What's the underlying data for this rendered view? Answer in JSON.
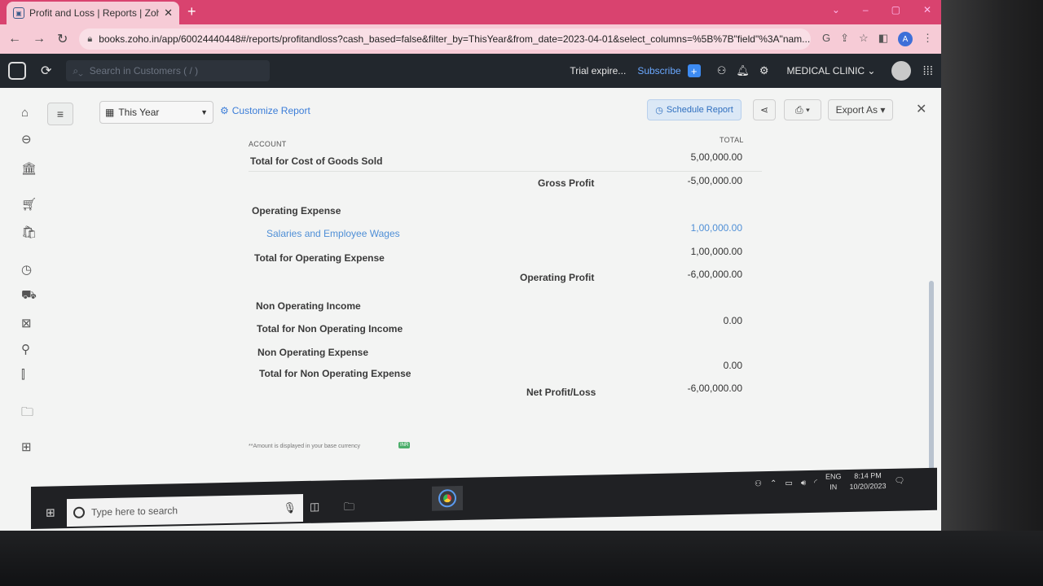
{
  "browser": {
    "tab_title": "Profit and Loss | Reports | Zoho",
    "url": "books.zoho.in/app/60024440448#/reports/profitandloss?cash_based=false&filter_by=ThisYear&from_date=2023-04-01&select_columns=%5B%7B\"field\"%3A\"nam...",
    "profile_initial": "A",
    "accent": "#d9436f"
  },
  "header": {
    "search_placeholder": "Search in Customers ( / )",
    "trial_text": "Trial expire...",
    "subscribe_label": "Subscribe",
    "org_name": "MEDICAL CLINIC"
  },
  "toolbar": {
    "period": "This Year",
    "customize_label": "Customize Report",
    "schedule_label": "Schedule Report",
    "export_label": "Export As"
  },
  "report": {
    "col_account": "ACCOUNT",
    "col_total": "TOTAL",
    "rows": {
      "cogs_total_label": "Total for Cost of Goods Sold",
      "cogs_total_value": "5,00,000.00",
      "gross_profit_label": "Gross Profit",
      "gross_profit_value": "-5,00,000.00",
      "opex_heading": "Operating Expense",
      "salaries_label": "Salaries and Employee Wages",
      "salaries_value": "1,00,000.00",
      "opex_total_label": "Total for Operating Expense",
      "opex_total_value": "1,00,000.00",
      "operating_profit_label": "Operating Profit",
      "operating_profit_value": "-6,00,000.00",
      "noi_heading": "Non Operating Income",
      "noi_total_label": "Total for Non Operating Income",
      "noi_total_value": "0.00",
      "noe_heading": "Non Operating Expense",
      "noe_total_label": "Total for Non Operating Expense",
      "noe_total_value": "0.00",
      "net_label": "Net Profit/Loss",
      "net_value": "-6,00,000.00"
    },
    "footnote": "**Amount is displayed in your base currency",
    "currency": "INR"
  },
  "taskbar": {
    "search_placeholder": "Type here to search",
    "lang_top": "ENG",
    "lang_bottom": "IN",
    "time": "8:14 PM",
    "date": "10/20/2023"
  },
  "icons": [
    "zoho-logo-icon",
    "refresh-icon",
    "search-icon",
    "add-icon",
    "users-icon",
    "bell-icon",
    "settings-icon",
    "apps-grid-icon",
    "home-icon",
    "items-icon",
    "banking-icon",
    "sales-icon",
    "purchases-icon",
    "time-icon",
    "delivery-icon",
    "accountant-icon",
    "contacts-icon",
    "reports-icon",
    "documents-icon",
    "widgets-icon"
  ]
}
